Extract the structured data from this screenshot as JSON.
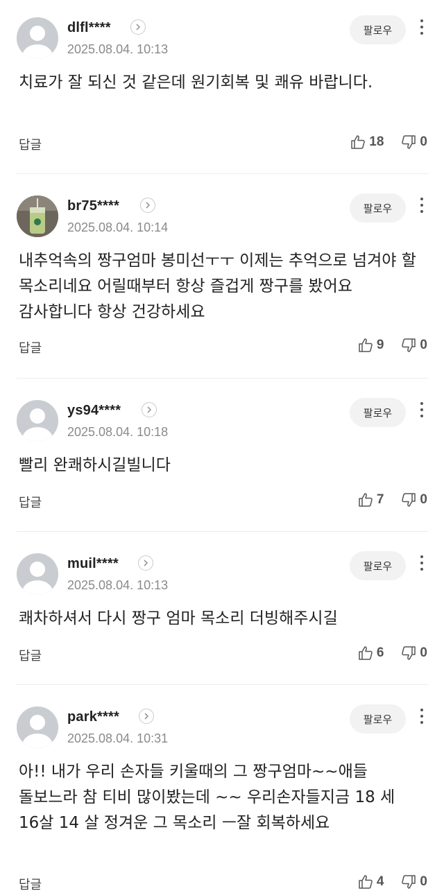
{
  "follow_label": "팔로우",
  "reply_label": "답글",
  "comments": [
    {
      "username": "dlfl****",
      "timestamp": "2025.08.04. 10:13",
      "text": "치료가 잘 되신 것 같은데 원기회복 및 쾌유 바랍니다.",
      "likes": "18",
      "dislikes": "0",
      "avatar": "default-avatar"
    },
    {
      "username": "br75****",
      "timestamp": "2025.08.04. 10:14",
      "text": "내추억속의 짱구엄마 봉미선ㅜㅜ 이제는 추억으로 넘겨야 할 목소리네요 어릴때부터 항상 즐겁게 짱구를 봤어요 감사합니다 항상 건강하세요",
      "likes": "9",
      "dislikes": "0",
      "avatar": "photo-avatar"
    },
    {
      "username": "ys94****",
      "timestamp": "2025.08.04. 10:18",
      "text": "빨리 완쾌하시길빌니다",
      "likes": "7",
      "dislikes": "0",
      "avatar": "default-avatar"
    },
    {
      "username": "muil****",
      "timestamp": "2025.08.04. 10:13",
      "text": "쾌차하셔서 다시 짱구 엄마 목소리 더빙해주시길",
      "likes": "6",
      "dislikes": "0",
      "avatar": "default-avatar"
    },
    {
      "username": "park****",
      "timestamp": "2025.08.04. 10:31",
      "text": "아!! 내가 우리 손자들 키울때의 그 짱구엄마~~애들 돌보느라 참 티비 많이봤는데 ~~ 우리손자들지금 18 세 16살 14 살 정겨운 그 목소리 ㅡ잘 회복하세요",
      "likes": "4",
      "dislikes": "0",
      "avatar": "default-avatar"
    }
  ]
}
